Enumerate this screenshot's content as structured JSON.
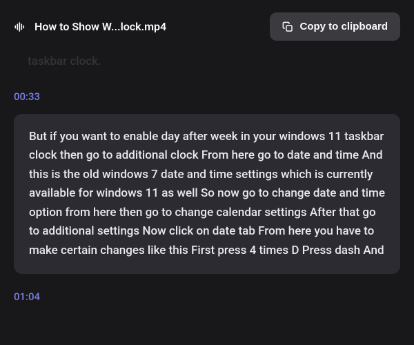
{
  "header": {
    "file_name": "How to Show W...lock.mp4",
    "copy_button_label": "Copy to clipboard"
  },
  "transcript": {
    "prev_fragment": "taskbar clock.",
    "timestamp_start": "00:33",
    "body": "But if you want to enable day after week in your windows 11 taskbar clock then go to additional clock From here go to date and time And this is the old windows 7 date and time settings which is currently available for windows 11 as well So now go to change date and time option from here then go to change calendar settings After that go to additional settings Now click on date tab From here you have to make certain changes like this First press 4 times D Press dash And",
    "timestamp_end": "01:04"
  }
}
